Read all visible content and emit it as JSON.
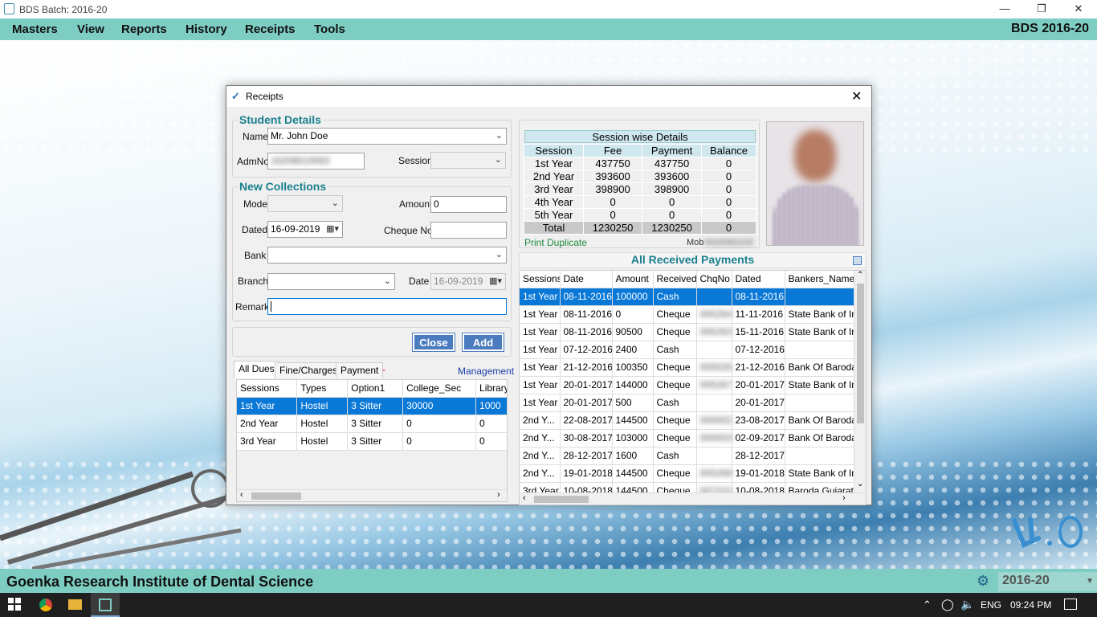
{
  "window": {
    "title": "BDS Batch: 2016-20"
  },
  "menu": [
    "Masters",
    "View",
    "Reports",
    "History",
    "Receipts",
    "Tools"
  ],
  "batch_label": "BDS 2016-20",
  "footer": {
    "institute": "Goenka Research Institute of Dental Science",
    "year": "2016-20"
  },
  "taskbar": {
    "lang": "ENG",
    "time": "09:24 PM"
  },
  "dialog": {
    "title": "Receipts",
    "student": {
      "heading": "Student Details",
      "name_label": "Name",
      "name_value": "Mr. John Doe",
      "admno_label": "AdmNo",
      "admno_value": "16208010063",
      "session_label": "Session",
      "session_value": ""
    },
    "collections": {
      "heading": "New Collections",
      "mode_label": "Mode",
      "mode_value": "",
      "amount_label": "Amount",
      "amount_value": "0",
      "dated_label": "Dated",
      "dated_value": "16-09-2019",
      "cheque_label": "Cheque No",
      "cheque_value": "",
      "bank_label": "Bank",
      "bank_value": "",
      "branch_label": "Branch",
      "branch_value": "",
      "date_label": "Date",
      "date_value": "16-09-2019",
      "remark_label": "Remark",
      "remark_value": ""
    },
    "buttons": {
      "close": "Close",
      "add": "Add"
    },
    "tabs": [
      "All Dues",
      "Fine/Charges",
      "Payment"
    ],
    "tab_marker": "-",
    "management_link": "Management",
    "dues": {
      "columns": [
        "Sessions",
        "Types",
        "Option1",
        "College_Sec",
        "Library"
      ],
      "rows": [
        [
          "1st Year",
          "Hostel",
          "3 Sitter",
          "30000",
          "1000"
        ],
        [
          "2nd Year",
          "Hostel",
          "3 Sitter",
          "0",
          "0"
        ],
        [
          "3rd Year",
          "Hostel",
          "3 Sitter",
          "0",
          "0"
        ]
      ]
    },
    "session_details": {
      "title": "Session wise Details",
      "columns": [
        "Session",
        "Fee",
        "Payment",
        "Balance"
      ],
      "rows": [
        [
          "1st Year",
          "437750",
          "437750",
          "0"
        ],
        [
          "2nd Year",
          "393600",
          "393600",
          "0"
        ],
        [
          "3rd Year",
          "398900",
          "398900",
          "0"
        ],
        [
          "4th Year",
          "0",
          "0",
          "0"
        ],
        [
          "5th Year",
          "0",
          "0",
          "0"
        ]
      ],
      "total": [
        "Total",
        "1230250",
        "1230250",
        "0"
      ]
    },
    "print_duplicate": "Print Duplicate",
    "mob_label": "Mob",
    "mob_value": "9420083153",
    "payments": {
      "title": "All Received Payments",
      "columns": [
        "Sessions",
        "Date",
        "Amount",
        "Received",
        "ChqNo",
        "Dated",
        "Bankers_Name"
      ],
      "rows": [
        [
          "1st Year",
          "08-11-2016",
          "100000",
          "Cash",
          "",
          "08-11-2016",
          ""
        ],
        [
          "1st Year",
          "08-11-2016",
          "0",
          "Cheque",
          "005264",
          "11-11-2016",
          "State Bank of Ind"
        ],
        [
          "1st Year",
          "08-11-2016",
          "90500",
          "Cheque",
          "005263",
          "15-11-2016",
          "State Bank of Ind"
        ],
        [
          "1st Year",
          "07-12-2016",
          "2400",
          "Cash",
          "",
          "07-12-2016",
          ""
        ],
        [
          "1st Year",
          "21-12-2016",
          "100350",
          "Cheque",
          "000026",
          "21-12-2016",
          "Bank Of Baroda"
        ],
        [
          "1st Year",
          "20-01-2017",
          "144000",
          "Cheque",
          "005267",
          "20-01-2017",
          "State Bank of Ind"
        ],
        [
          "1st Year",
          "20-01-2017",
          "500",
          "Cash",
          "",
          "20-01-2017",
          ""
        ],
        [
          "2nd Y...",
          "22-08-2017",
          "144500",
          "Cheque",
          "000002",
          "23-08-2017",
          "Bank Of Baroda"
        ],
        [
          "2nd Y...",
          "30-08-2017",
          "103000",
          "Cheque",
          "000003",
          "02-09-2017",
          "Bank Of Baroda"
        ],
        [
          "2nd Y...",
          "28-12-2017",
          "1600",
          "Cash",
          "",
          "28-12-2017",
          ""
        ],
        [
          "2nd Y...",
          "19-01-2018",
          "144500",
          "Cheque",
          "005269",
          "19-01-2018",
          "State Bank of Ind"
        ],
        [
          "3rd Year",
          "10-08-2018",
          "144500",
          "Cheque",
          "007310",
          "10-08-2018",
          "Baroda Gujarat G"
        ]
      ]
    }
  }
}
